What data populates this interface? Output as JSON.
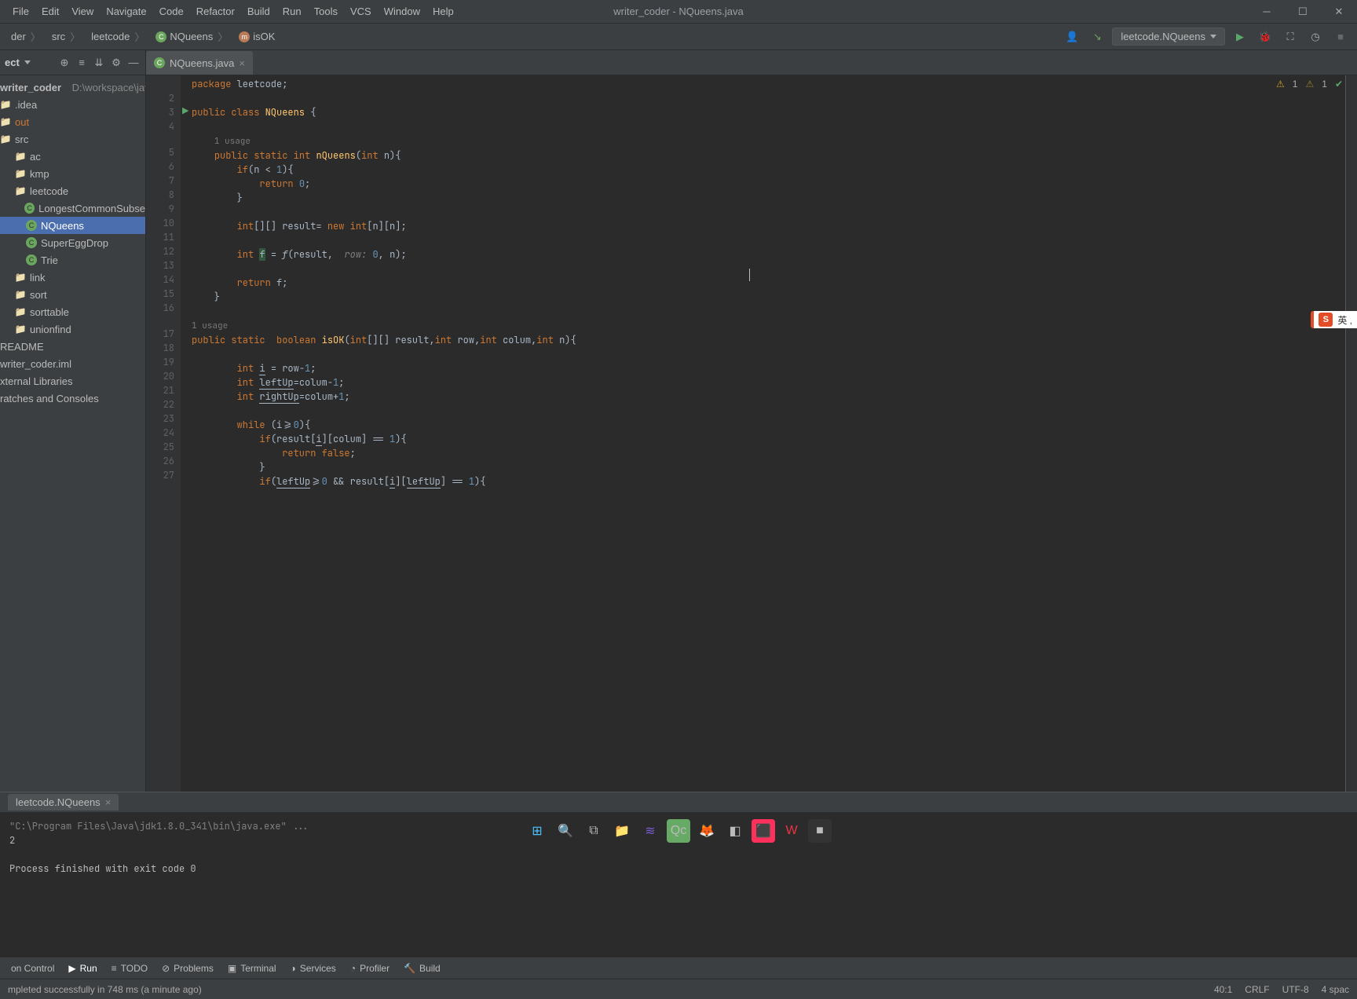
{
  "title": "writer_coder - NQueens.java",
  "menu": {
    "f": "File",
    "e": "Edit",
    "v": "View",
    "n": "Navigate",
    "c": "Code",
    "r": "Refactor",
    "b": "Build",
    "u": "Run",
    "t": "Tools",
    "vc": "VCS",
    "w": "Window",
    "h": "Help"
  },
  "breadcrumb": {
    "b0": "der",
    "b1": "src",
    "b2": "leetcode",
    "b3": "NQueens",
    "b4": "isOK"
  },
  "runconfig": {
    "label": "leetcode.NQueens"
  },
  "sidebar": {
    "title": "ect",
    "root": {
      "name": "writer_coder",
      "path": "D:\\workspace\\java"
    },
    "idea": ".idea",
    "out": "out",
    "src": "src",
    "ac": "ac",
    "kmp": "kmp",
    "leetcode": "leetcode",
    "lcs": "LongestCommonSubse",
    "nqueens": "NQueens",
    "segd": "SuperEggDrop",
    "trie": "Trie",
    "link": "link",
    "sort": "sort",
    "sorttable": "sorttable",
    "unionfind": "unionfind",
    "readme": "README",
    "iml": "writer_coder.iml",
    "extlib": "xternal Libraries",
    "scratch": "ratches and Consoles"
  },
  "tab": {
    "name": "NQueens.java"
  },
  "inspection": {
    "warn": "1",
    "weak": "1"
  },
  "code_usage1": "1 usage",
  "code_usage2": "1 usage",
  "gutter_lines": [
    "",
    "2",
    "3",
    "4",
    "5",
    "6",
    "7",
    "8",
    "9",
    "10",
    "11",
    "12",
    "13",
    "14",
    "15",
    "16",
    "17",
    "18",
    "19",
    "20",
    "21",
    "22",
    "23",
    "24",
    "25",
    "26",
    "27"
  ],
  "run": {
    "tab": "leetcode.NQueens",
    "cmd": "\"C:\\Program Files\\Java\\jdk1.8.0_341\\bin\\java.exe\" ...",
    "out": "2",
    "exit": "Process finished with exit code 0"
  },
  "bottom_tabs": {
    "vc": "on Control",
    "run": "Run",
    "todo": "TODO",
    "problems": "Problems",
    "terminal": "Terminal",
    "services": "Services",
    "profiler": "Profiler",
    "build": "Build"
  },
  "status": {
    "msg": "mpleted successfully in 748 ms (a minute ago)",
    "pos": "40:1",
    "eol": "CRLF",
    "enc": "UTF-8",
    "indent": "4 spac"
  },
  "ime": {
    "badge": "S",
    "lang": "英 ,"
  }
}
